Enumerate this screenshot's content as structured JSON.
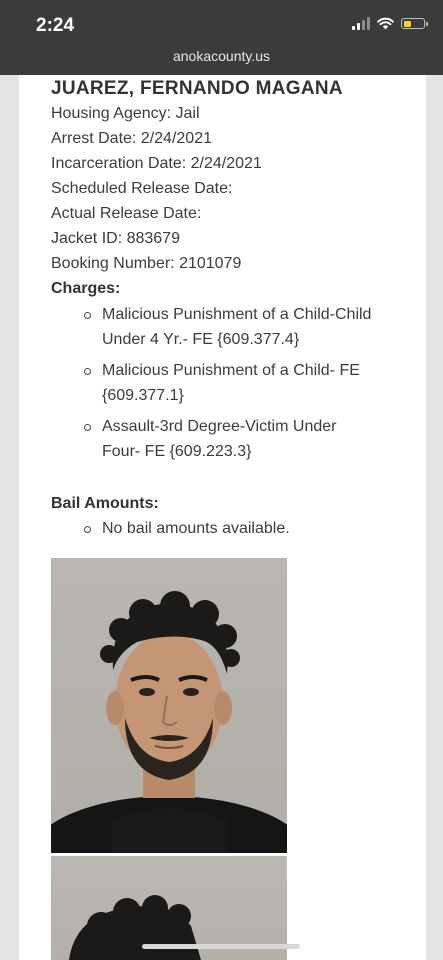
{
  "status_bar": {
    "time": "2:24",
    "url": "anokacounty.us",
    "battery_fill_fraction": 0.4
  },
  "inmate": {
    "name": "JUAREZ, FERNANDO MAGANA",
    "housing_agency": "Housing Agency: Jail",
    "arrest_date": "Arrest Date: 2/24/2021",
    "incarceration_date": "Incarceration Date: 2/24/2021",
    "scheduled_release_date": "Scheduled Release Date:",
    "actual_release_date": "Actual Release Date:",
    "jacket_id": "Jacket ID: 883679",
    "booking_number": "Booking Number: 2101079"
  },
  "charges": {
    "label": "Charges:",
    "items": [
      {
        "line1": "Malicious Punishment of a Child-Child",
        "line2": "Under 4 Yr.- FE {609.377.4}"
      },
      {
        "line1": "Malicious Punishment of a Child- FE",
        "line2": "{609.377.1}"
      },
      {
        "line1": "Assault-3rd Degree-Victim Under",
        "line2": "Four- FE {609.223.3}"
      }
    ]
  },
  "bail": {
    "label": "Bail Amounts:",
    "items": [
      "No bail amounts available."
    ]
  },
  "photos": [
    {
      "icon": "mugshot-front-photo"
    },
    {
      "icon": "mugshot-side-photo"
    }
  ]
}
